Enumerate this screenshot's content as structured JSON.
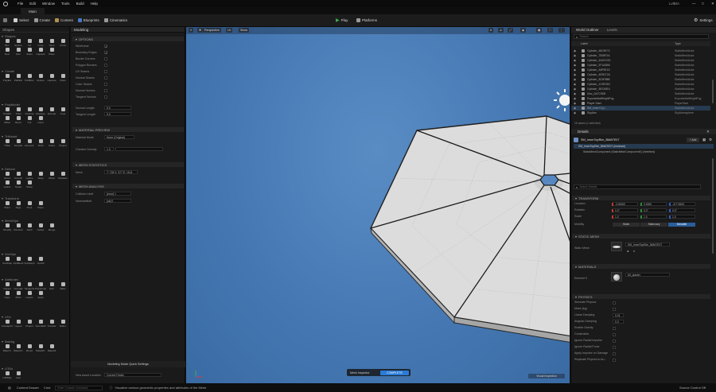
{
  "menubar": {
    "items": [
      "File",
      "Edit",
      "Window",
      "Tools",
      "Build",
      "Help"
    ],
    "project_name": "LvlBIA"
  },
  "tab": {
    "label": "Main"
  },
  "toolbar": {
    "select_label": "Select",
    "create_label": "Create",
    "content_label": "Content",
    "blueprints_label": "Blueprints",
    "cinematics_label": "Cinematics",
    "play_label": "Play",
    "platforms_label": "Platforms",
    "settings_label": "Settings"
  },
  "left_panel": {
    "header": "Shapes",
    "sections": [
      {
        "title": "Shapes",
        "tools": [
          "Box",
          "Sphere",
          "Cyl",
          "Cone",
          "Torus",
          "Arrow",
          "Rect",
          "Disc",
          "Stairs",
          "Capsule",
          "Plane"
        ]
      },
      {
        "title": "Create",
        "tools": [
          "PolyExt",
          "PathExt",
          "PathRev",
          "Sphere",
          "Capsule",
          "Draw"
        ]
      },
      {
        "title": "PolyModel",
        "tools": [
          "PolyEd",
          "TriEd",
          "PolyGrp",
          "Displace",
          "Extrude",
          "Inset",
          "Offset",
          "Bevel",
          "Cut",
          "Insert"
        ]
      },
      {
        "title": "TriModel",
        "tools": [
          "TriSel",
          "Simplify",
          "Remesh",
          "Weld",
          "Holes",
          "Project"
        ]
      },
      {
        "title": "Deform",
        "tools": [
          "Vertex",
          "Smooth",
          "Lattice",
          "Warp",
          "Offset",
          "Displace",
          "Lattice",
          "Sculpt",
          "Sharp"
        ]
      },
      {
        "title": "Transform",
        "tools": [
          "Xform",
          "Align",
          "Pivot",
          "Place"
        ]
      },
      {
        "title": "MeshOps",
        "tools": [
          "Simplify",
          "Remesh",
          "Weld",
          "Jacket",
          "Merge"
        ]
      },
      {
        "title": "VoxOps",
        "tools": [
          "VoxWrap",
          "VoxBlend",
          "VoxMorph",
          "VoxFill"
        ]
      },
      {
        "title": "Attributes",
        "tools": [
          "Inspect",
          "Normals",
          "Tangents",
          "PolyGroup",
          "Edit",
          "Bake",
          "Copy",
          "Paint",
          "Layers",
          "Apply"
        ]
      },
      {
        "title": "UVs",
        "tools": [
          "UnwrapUV",
          "Layout",
          "Project",
          "SeamEdit",
          "Transfer",
          "Editor"
        ]
      },
      {
        "title": "Baking",
        "tools": [
          "BakeTx",
          "BakeVtx",
          "Morph",
          "BakeRC",
          "BakeAll"
        ]
      },
      {
        "title": "LODs",
        "tools": [
          "LODMgr",
          "Auto"
        ]
      }
    ]
  },
  "props_panel": {
    "tab": "Modeling",
    "sec_options": "OPTIONS",
    "option_rows": [
      {
        "label": "Wireframe",
        "checked": true
      },
      {
        "label": "Boundary Edges",
        "checked": true
      },
      {
        "label": "Border Corners",
        "checked": false
      },
      {
        "label": "Polygon Borders",
        "checked": false
      },
      {
        "label": "UV Seams",
        "checked": false
      },
      {
        "label": "Normal Seams",
        "checked": false
      },
      {
        "label": "Color Seams",
        "checked": false
      },
      {
        "label": "Normal Vectors",
        "checked": false
      },
      {
        "label": "Tangent Vectors",
        "checked": false
      }
    ],
    "normal_length_label": "Normal Length",
    "normal_length_value": "5.0",
    "tangent_length_label": "Tangent Length",
    "tangent_length_value": "5.0",
    "sec_material": "MATERIAL PREVIEW",
    "material_mode_label": "Material Mode",
    "material_mode_value": "None (Original)",
    "checker_label": "Checker Density",
    "checker_value": "1.0",
    "sec_mesh_stats": "MESH STATISTICS",
    "mesh_label": "Mesh",
    "mesh_value": "T: 728 V: 377 E: 1104",
    "sec_mesh_analysis": "MESH ANALYSIS",
    "collision_label": "Collision Limit",
    "collision_value": "[error] 1",
    "nonmanifold_label": "Nonmanifold",
    "nonmanifold_value": "[ok] 0",
    "footer_title": "Modeling Mode Quick Settings",
    "asset_location_label": "New Asset Location",
    "asset_location_value": "Current Folder"
  },
  "viewport": {
    "perspective": "Perspective",
    "lit": "Lit",
    "show": "Show",
    "bottom_label": "Mesh Inspector",
    "complete_button": "COMPLETE",
    "corner_label": "Visual Inspection"
  },
  "right_panel": {
    "outliner_tab": "World Outliner",
    "levels_tab": "Levels",
    "search_placeholder": "Search",
    "col_label": "Label",
    "col_type": "Type",
    "outliner_rows": [
      {
        "name": "Cylinder_48C9E74",
        "type": "StaticMeshActor"
      },
      {
        "name": "Cylinder_7B39F2A",
        "type": "StaticMeshActor"
      },
      {
        "name": "Cylinder_4A1EC0D",
        "type": "StaticMeshActor"
      },
      {
        "name": "Cylinder_2F1A3B8",
        "type": "StaticMeshActor"
      },
      {
        "name": "Cylinder_A5F9E15",
        "type": "StaticMeshActor"
      },
      {
        "name": "Cylinder_4E9D72A",
        "type": "StaticMeshActor"
      },
      {
        "name": "Cylinder_5D3F88B",
        "type": "StaticMeshActor"
      },
      {
        "name": "Cylinder_1C9E0D2",
        "type": "StaticMeshActor"
      },
      {
        "name": "Cylinder_3B7A9E4",
        "type": "StaticMeshActor"
      },
      {
        "name": "Disc_0A7C9D8",
        "type": "StaticMeshActor"
      },
      {
        "name": "ExponentialHeightFog",
        "type": "ExponentialHeightFog"
      },
      {
        "name": "Player Start",
        "type": "PlayerStart"
      },
      {
        "name": "SM_Inner+Cyl...",
        "type": "StaticMeshActor"
      },
      {
        "name": "SkyAtm",
        "type": "SkyAtmosphere"
      }
    ],
    "actor_count": "15 actors (1 selected)",
    "details_tab": "Details",
    "selected_name": "SM_InnerTopRim_BMATE07",
    "add_button": "+ Add",
    "component_root": "SM_InnerTopRim_BMATE07 (Instance)",
    "component_child": "StaticMeshComponent (StaticMeshComponent0) (Inherited)",
    "details_search": "Search Details",
    "sec_transform": "TRANSFORM",
    "location_label": "Location",
    "location": [
      "-3.00000",
      "0.0000",
      "-477.5525"
    ],
    "rotation_label": "Rotation",
    "rotation": [
      "0.0°",
      "0.0°",
      "0.0°"
    ],
    "scale_label": "Scale",
    "scale": [
      "1.0",
      "1.0",
      "1.0"
    ],
    "mobility_label": "Mobility",
    "mobility_options": [
      "Static",
      "Stationary",
      "Movable"
    ],
    "sec_static_mesh": "STATIC MESH",
    "static_mesh_label": "Static Mesh",
    "static_mesh_value": "SM_InnerTopRim_BMATE07",
    "sec_materials": "MATERIALS",
    "element_label": "Element 0",
    "material_value": "MI_plaster",
    "sec_physics": "PHYSICS",
    "physics_rows": [
      {
        "label": "Simulate Physics",
        "value": ""
      },
      {
        "label": "Mass (kg)",
        "value": ""
      },
      {
        "label": "Linear Damping",
        "value": "0.01"
      },
      {
        "label": "Angular Damping",
        "value": "0.0"
      },
      {
        "label": "Enable Gravity",
        "value": ""
      },
      {
        "label": "Constraints",
        "value": ""
      },
      {
        "label": "Ignore Radial Impulse",
        "value": ""
      },
      {
        "label": "Ignore Radial Force",
        "value": ""
      },
      {
        "label": "Apply Impulse on Damage",
        "value": ""
      },
      {
        "label": "Replicate Physics to Au...",
        "value": ""
      }
    ]
  },
  "statusbar": {
    "content_drawer": "Content Drawer",
    "cmd": "Cmd",
    "console_placeholder": "Enter Console Command",
    "message": "Visualize various geometric properties and attributes of the Mesh",
    "source_control": "Source Control Off"
  },
  "colors": {
    "viewport_sky": "#4477b2",
    "selection": "#263a50",
    "complete_button": "#2a7bd6",
    "play": "#3fae4f"
  }
}
